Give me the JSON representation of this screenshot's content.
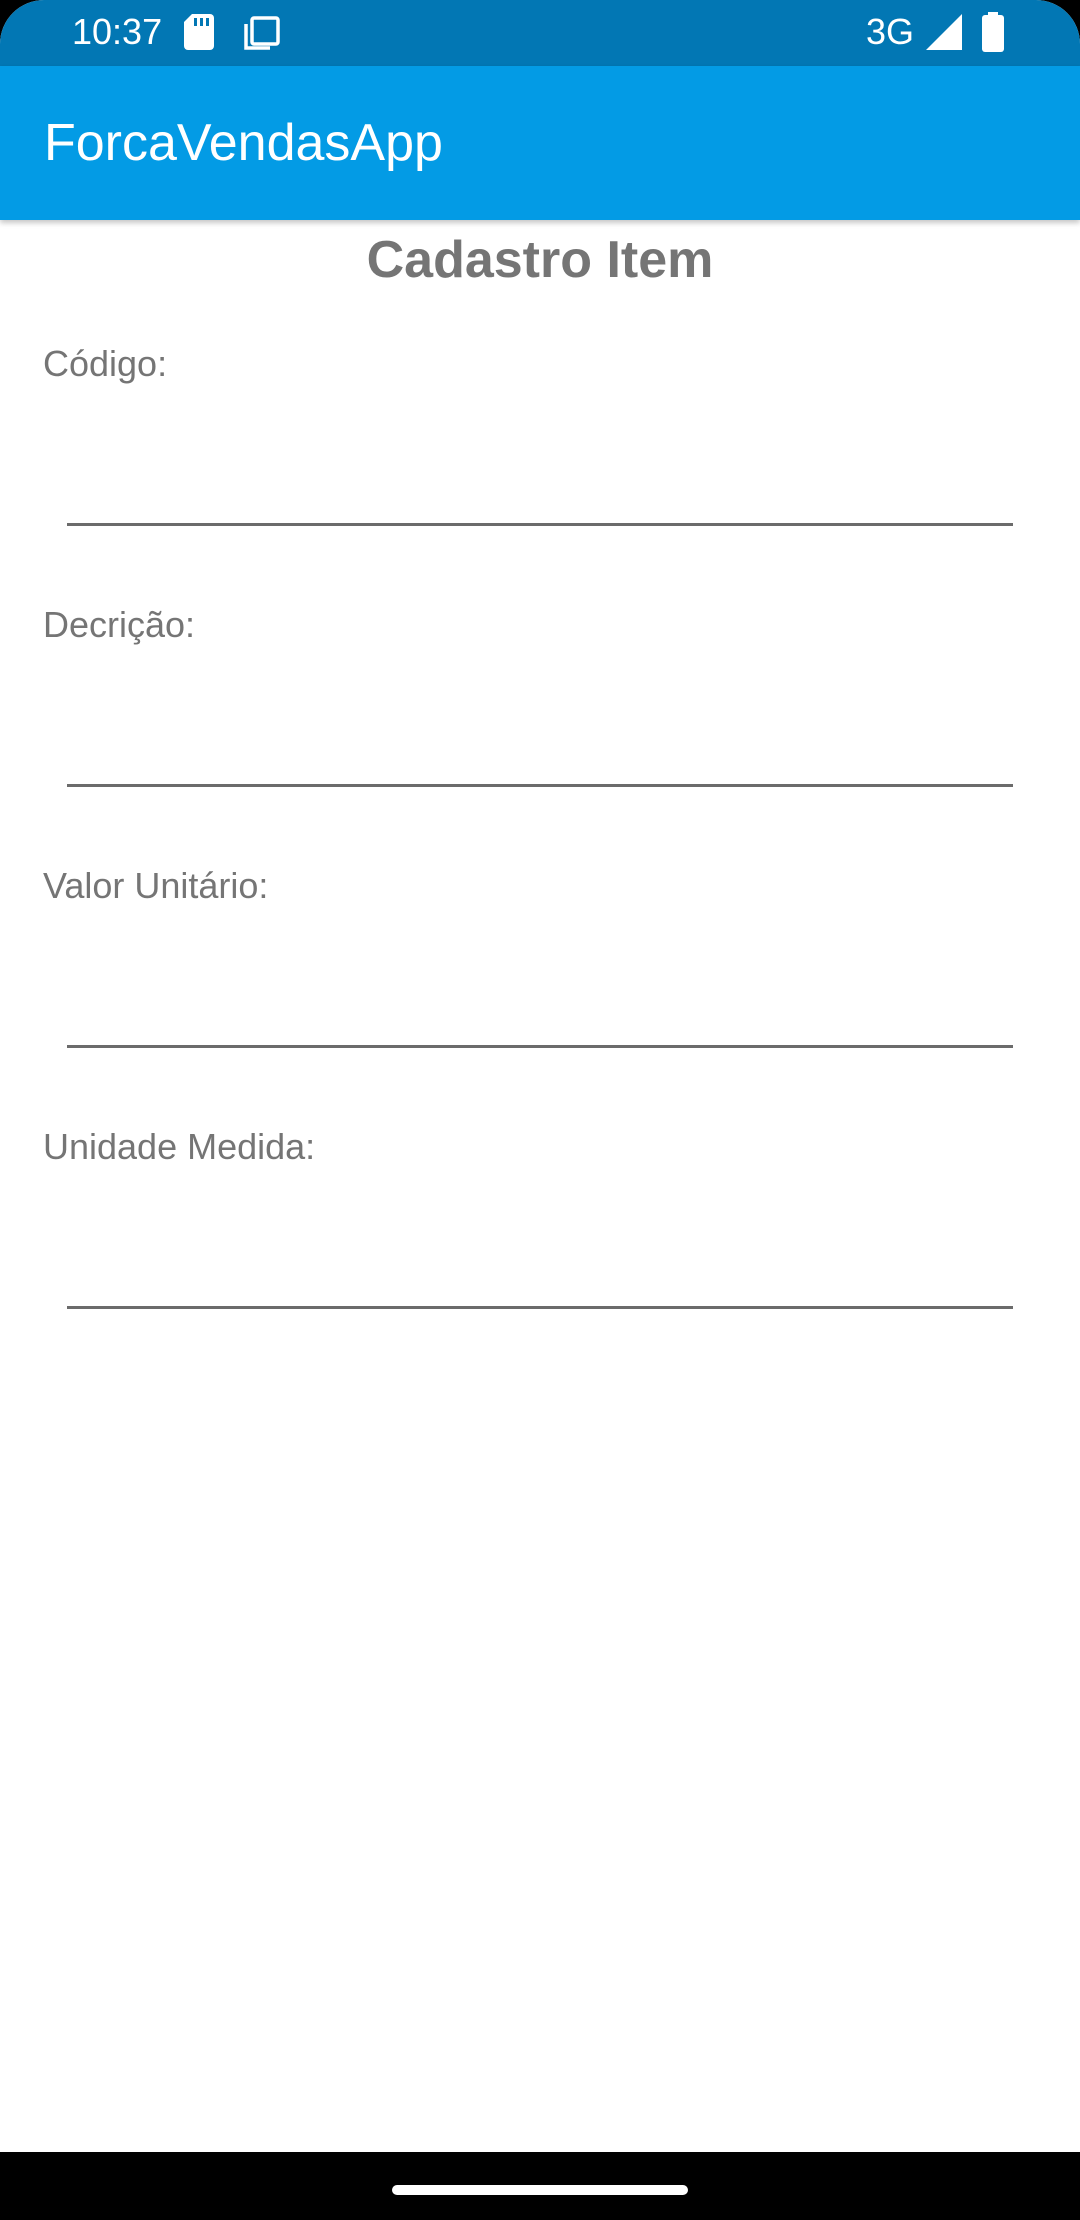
{
  "status_bar": {
    "time": "10:37",
    "network": "3G",
    "color": "#0277B4",
    "icons": [
      "sd-card-icon",
      "copy-icon",
      "signal-icon",
      "battery-icon"
    ]
  },
  "app_bar": {
    "title": "ForcaVendasApp",
    "color": "#039BE5"
  },
  "form": {
    "title": "Cadastro Item",
    "fields": [
      {
        "label": "Código:",
        "value": ""
      },
      {
        "label": "Decrição:",
        "value": ""
      },
      {
        "label": "Valor Unitário:",
        "value": ""
      },
      {
        "label": "Unidade Medida:",
        "value": ""
      }
    ]
  }
}
